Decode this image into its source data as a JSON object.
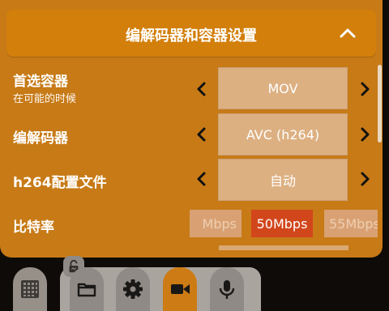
{
  "header": {
    "title": "编解码器和容器设置"
  },
  "rows": [
    {
      "label": "首选容器",
      "sub": "在可能的时候",
      "value": "MOV"
    },
    {
      "label": "编解码器",
      "value": "AVC (h264)"
    },
    {
      "label": "h264配置文件",
      "value": "自动"
    }
  ],
  "bitrate": {
    "label": "比特率",
    "options": [
      "Mbps",
      "50Mbps",
      "55Mbps"
    ],
    "selected_color": "#d2461c"
  },
  "dock": {
    "icons": [
      "grid-icon",
      "lock-icon",
      "folder-icon",
      "gear-icon",
      "video-camera-icon",
      "microphone-icon"
    ],
    "accent": "#cd7b14"
  },
  "colors": {
    "panel": "#c77a16",
    "header": "#d37f0b",
    "value_box": "#ddb082"
  }
}
